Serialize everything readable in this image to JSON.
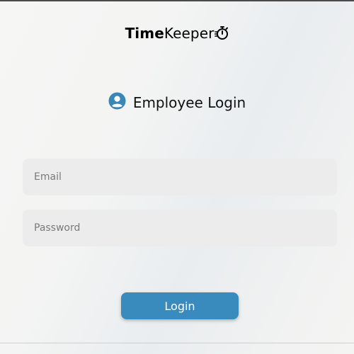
{
  "logo": {
    "bold_part": "Time",
    "light_part": "Keeper",
    "icon": "stopwatch-icon"
  },
  "heading": {
    "icon": "user-circle-icon",
    "title": "Employee Login"
  },
  "form": {
    "email_placeholder": "Email",
    "password_placeholder": "Password",
    "login_label": "Login"
  },
  "colors": {
    "accent": "#3a8bbd",
    "input_bg": "#ececec",
    "user_icon": "#3a86b4"
  }
}
